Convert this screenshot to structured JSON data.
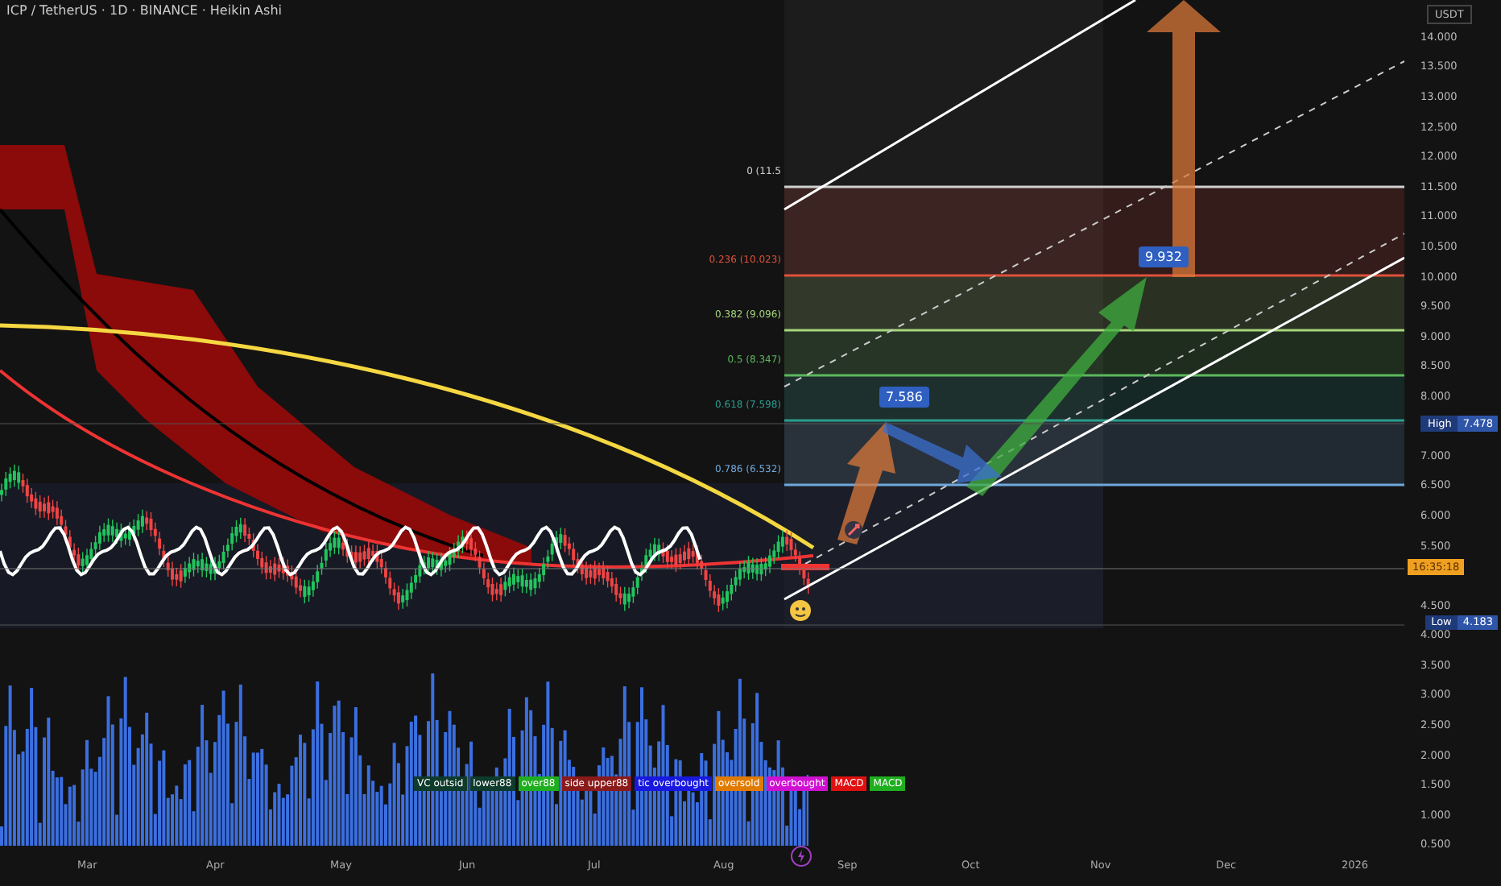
{
  "header": {
    "title": "ICP / TetherUS · 1D · BINANCE · Heikin Ashi"
  },
  "price_axis": {
    "unit": "USDT",
    "upper_labels": [
      "14.000",
      "13.500",
      "13.000",
      "12.500",
      "12.000",
      "11.500",
      "11.000",
      "10.500",
      "10.000",
      "9.500",
      "9.000",
      "8.500",
      "8.000"
    ],
    "middle_labels": [
      "7.000",
      "6.500",
      "6.000",
      "5.500"
    ],
    "lower_labels": [
      "4.500",
      "4.000"
    ]
  },
  "markers": {
    "high": {
      "label": "High",
      "value": "7.478"
    },
    "low": {
      "label": "Low",
      "value": "4.183"
    },
    "countdown": "16:35:18"
  },
  "fib_levels": [
    {
      "label": "0 (11.5",
      "color": "#d0d0d0"
    },
    {
      "label": "0.236 (10.023)",
      "color": "#e0503c"
    },
    {
      "label": "0.382 (9.096)",
      "color": "#a5d67a"
    },
    {
      "label": "0.5 (8.347)",
      "color": "#5cb85c"
    },
    {
      "label": "0.618 (7.598)",
      "color": "#2a9d8f"
    },
    {
      "label": "0.786 (6.532)",
      "color": "#6fa8dc"
    }
  ],
  "targets": [
    "7.586",
    "9.932"
  ],
  "volume_axis": {
    "labels": [
      "3.500",
      "3.000",
      "2.500",
      "2.000",
      "1.500",
      "1.000",
      "0.500"
    ]
  },
  "indicator_tags": [
    {
      "text": "VC outsid",
      "color": "#0e3b2c"
    },
    {
      "text": "lower88",
      "color": "#0e3b2c"
    },
    {
      "text": "over88",
      "color": "#1fae1f"
    },
    {
      "text": "side upper88",
      "color": "#8b1a1a"
    },
    {
      "text": "tic overbought",
      "color": "#1818e0"
    },
    {
      "text": "oversold",
      "color": "#e07b00"
    },
    {
      "text": "overbought",
      "color": "#d010d0"
    },
    {
      "text": "MACD",
      "color": "#e01010"
    },
    {
      "text": "MACD",
      "color": "#1fae1f"
    }
  ],
  "time_axis": [
    "Mar",
    "Apr",
    "May",
    "Jun",
    "Jul",
    "Aug",
    "Sep",
    "Oct",
    "Nov",
    "Dec",
    "2026"
  ]
}
